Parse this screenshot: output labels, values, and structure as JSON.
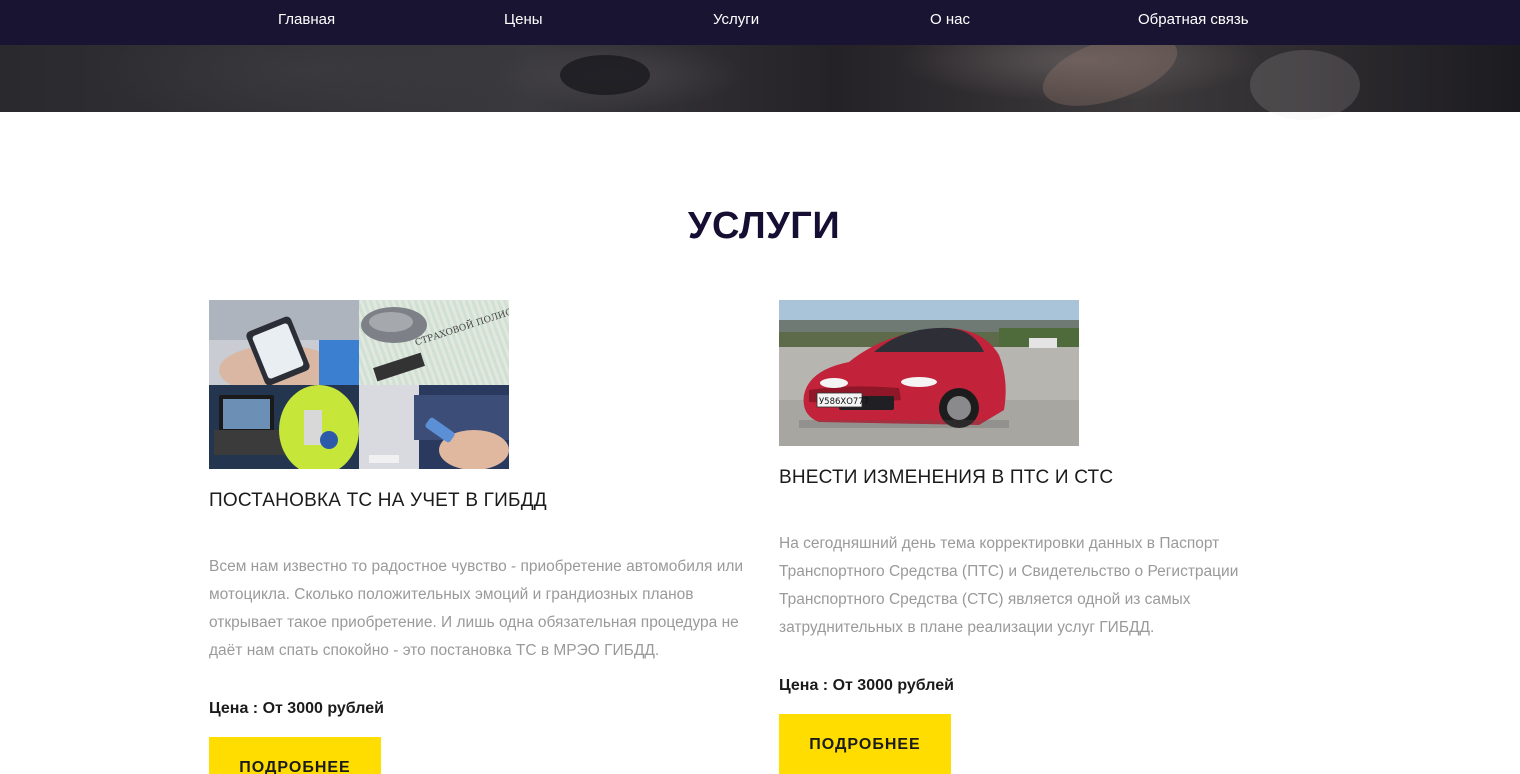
{
  "nav": {
    "items": [
      {
        "label": "Главная"
      },
      {
        "label": "Цены"
      },
      {
        "label": "Услуги"
      },
      {
        "label": "О нас"
      },
      {
        "label": "Обратная связь"
      }
    ]
  },
  "services": {
    "title": "УСЛУГИ",
    "cards": [
      {
        "title": "ПОСТАНОВКА ТС НА УЧЕТ В ГИБДД",
        "description": "Всем нам известно то радостное чувство - приобретение автомобиля или мотоцикла. Сколько положительных эмоций и грандиозных планов открывает такое приобретение. И лишь одна обязательная процедура не даёт нам спать спокойно - это постановка ТС в МРЭО ГИБДД.",
        "price": "Цена : От 3000 рублей",
        "button_label": "ПОДРОБНЕЕ",
        "image": {
          "plate_text": "",
          "policy_text": "СТРАХОВОЙ ПОЛИС"
        }
      },
      {
        "title": "ВНЕСТИ ИЗМЕНЕНИЯ В ПТС И СТС",
        "description": "На сегодняшний день тема корректировки данных в Паспорт Транспортного Средства (ПТС) и Свидетельство о Регистрации Транспортного Средства (СТС) является одной из самых затруднительных в плане реализации услуг ГИБДД.",
        "price": "Цена : От 3000 рублей",
        "button_label": "ПОДРОБНЕЕ",
        "image": {
          "plate_text": "У586ХО777"
        }
      }
    ]
  },
  "colors": {
    "nav_bg": "#1a1433",
    "title": "#160f33",
    "button_bg": "#ffdd00",
    "desc_text": "#9a9a9a"
  }
}
